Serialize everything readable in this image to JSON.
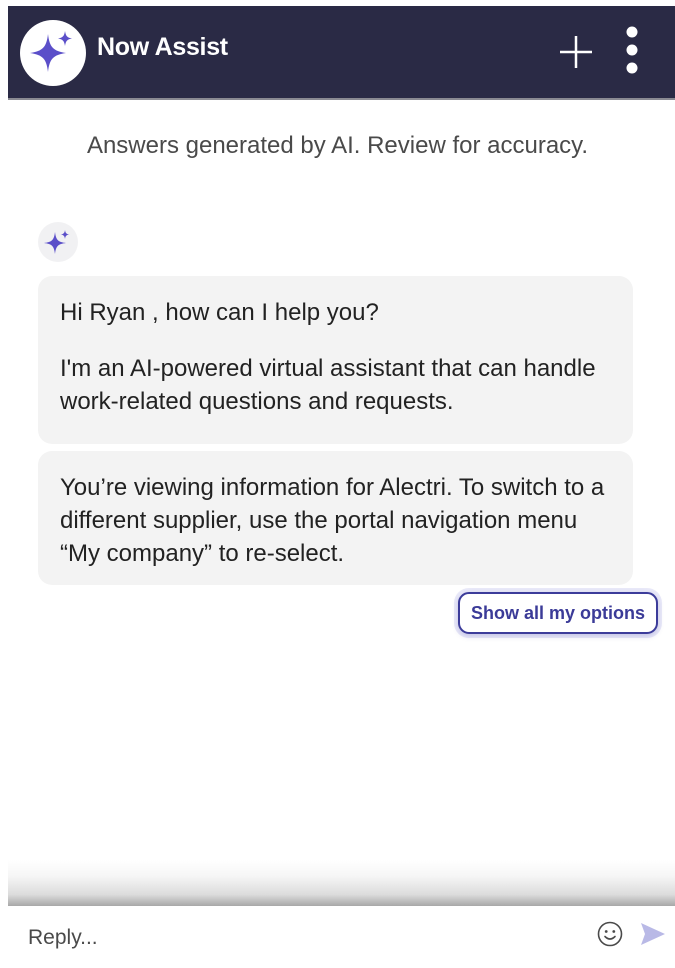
{
  "header": {
    "title": "Now Assist",
    "logo_icon": "sparkle-icon",
    "new_chat_icon": "plus-icon",
    "more_icon": "more-vertical-icon",
    "background_color": "#2a2a45",
    "accent_color": "#5b4fc9"
  },
  "disclaimer": "Answers generated by AI. Review for accuracy.",
  "conversation": {
    "bot_avatar_icon": "sparkle-icon",
    "messages": [
      {
        "paragraphs": [
          "Hi Ryan , how can I help you?",
          "I'm an AI-powered virtual assistant that can handle work-related questions and requests."
        ]
      },
      {
        "paragraphs": [
          "You’re viewing information for Alectri. To switch to a different supplier, use the portal navigation menu “My company” to re-select."
        ]
      }
    ],
    "options_button_label": "Show all my options"
  },
  "composer": {
    "placeholder": "Reply...",
    "emoji_icon": "smiley-icon",
    "send_icon": "send-icon"
  }
}
